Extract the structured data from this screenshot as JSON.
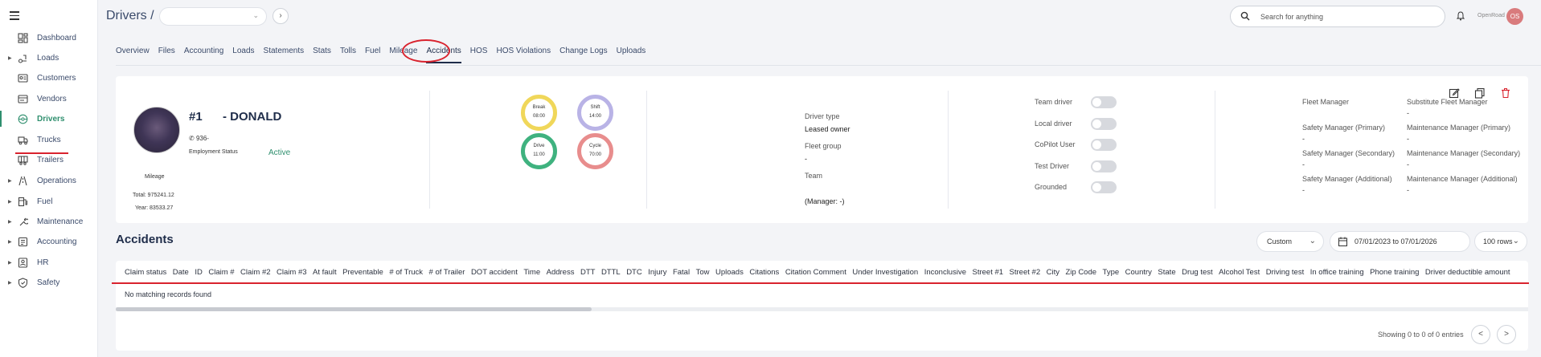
{
  "sidebar": {
    "items": [
      {
        "label": "Dashboard",
        "icon": "dashboard-icon",
        "caret": false
      },
      {
        "label": "Loads",
        "icon": "loads-icon",
        "caret": true
      },
      {
        "label": "Customers",
        "icon": "customers-icon",
        "caret": false
      },
      {
        "label": "Vendors",
        "icon": "vendors-icon",
        "caret": false
      },
      {
        "label": "Drivers",
        "icon": "drivers-icon",
        "caret": false,
        "active": true
      },
      {
        "label": "Trucks",
        "icon": "truck-icon",
        "caret": false
      },
      {
        "label": "Trailers",
        "icon": "trailer-icon",
        "caret": false
      },
      {
        "label": "Operations",
        "icon": "operations-icon",
        "caret": true
      },
      {
        "label": "Fuel",
        "icon": "fuel-icon",
        "caret": true
      },
      {
        "label": "Maintenance",
        "icon": "maintenance-icon",
        "caret": true
      },
      {
        "label": "Accounting",
        "icon": "accounting-icon",
        "caret": true
      },
      {
        "label": "HR",
        "icon": "hr-icon",
        "caret": true
      },
      {
        "label": "Safety",
        "icon": "safety-icon",
        "caret": true
      }
    ]
  },
  "header": {
    "title": "Drivers /",
    "driver_select_value": "",
    "next_label": "›",
    "search_placeholder": "Search for anything",
    "org": "OpenRoad",
    "user_initials": "OS"
  },
  "tabs": [
    "Overview",
    "Files",
    "Accounting",
    "Loads",
    "Statements",
    "Stats",
    "Tolls",
    "Fuel",
    "Mileage",
    "Accidents",
    "HOS",
    "HOS Violations",
    "Change Logs",
    "Uploads"
  ],
  "active_tab": "Accidents",
  "driver": {
    "number": "#1",
    "name": "- DONALD",
    "phone": "936-",
    "employment_status_label": "Employment Status",
    "employment_status": "Active",
    "mileage_label": "Mileage",
    "total": "Total: 975241.12",
    "year": "Year: 83533.27"
  },
  "hos": [
    {
      "label": "Break",
      "value": "08:00",
      "color": "#f0d75a"
    },
    {
      "label": "Shift",
      "value": "14:00",
      "color": "#b9b3e6"
    },
    {
      "label": "Drive",
      "value": "11:00",
      "color": "#3fb27f"
    },
    {
      "label": "Cycle",
      "value": "70:00",
      "color": "#e88d8d"
    }
  ],
  "details": {
    "driver_type_label": "Driver type",
    "driver_type": "Leased owner",
    "fleet_group_label": "Fleet group",
    "fleet_group": "-",
    "team_label": "Team",
    "manager": "(Manager: -)"
  },
  "toggles": [
    {
      "label": "Team driver",
      "on": false
    },
    {
      "label": "Local driver",
      "on": false
    },
    {
      "label": "CoPilot User",
      "on": false
    },
    {
      "label": "Test Driver",
      "on": false
    },
    {
      "label": "Grounded",
      "on": false
    }
  ],
  "managers": [
    {
      "label": "Fleet Manager",
      "value": ""
    },
    {
      "label": "Substitute Fleet Manager",
      "value": "-"
    },
    {
      "label": "Safety Manager (Primary)",
      "value": "-"
    },
    {
      "label": "Maintenance Manager (Primary)",
      "value": "-"
    },
    {
      "label": "Safety Manager (Secondary)",
      "value": "-"
    },
    {
      "label": "Maintenance Manager (Secondary)",
      "value": "-"
    },
    {
      "label": "Safety Manager (Additional)",
      "value": "-"
    },
    {
      "label": "Maintenance Manager (Additional)",
      "value": "-"
    }
  ],
  "accidents": {
    "title": "Accidents",
    "range_type": "Custom",
    "date_range": "07/01/2023 to 07/01/2026",
    "rows_per_page": "100 rows",
    "columns": [
      "Claim status",
      "Date",
      "ID",
      "Claim #",
      "Claim #2",
      "Claim #3",
      "At fault",
      "Preventable",
      "# of Truck",
      "# of Trailer",
      "DOT accident",
      "Time",
      "Address",
      "DTT",
      "DTTL",
      "DTC",
      "Injury",
      "Fatal",
      "Tow",
      "Uploads",
      "Citations",
      "Citation Comment",
      "Under Investigation",
      "Inconclusive",
      "Street #1",
      "Street #2",
      "City",
      "Zip Code",
      "Type",
      "Country",
      "State",
      "Drug test",
      "Alcohol Test",
      "Driving test",
      "In office training",
      "Phone training",
      "Driver deductible amount"
    ],
    "empty_message": "No matching records found",
    "showing": "Showing 0 to 0 of 0 entries",
    "prev_label": "<",
    "next_label": ">"
  },
  "colors": {
    "accent": "#2f8f6e",
    "highlight": "#d9232e"
  }
}
